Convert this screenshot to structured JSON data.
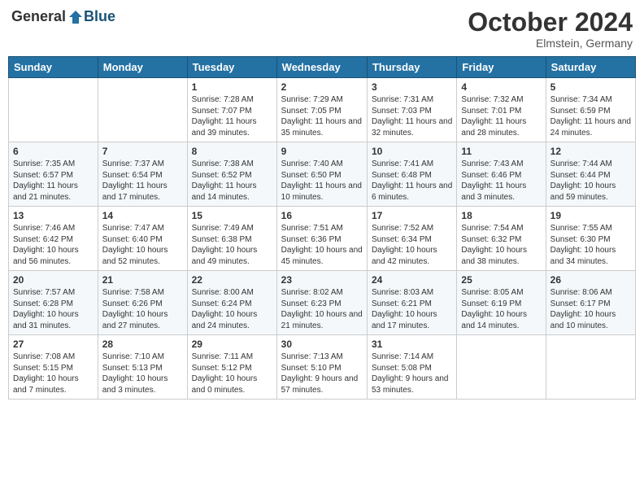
{
  "header": {
    "logo_general": "General",
    "logo_blue": "Blue",
    "month_title": "October 2024",
    "location": "Elmstein, Germany"
  },
  "weekdays": [
    "Sunday",
    "Monday",
    "Tuesday",
    "Wednesday",
    "Thursday",
    "Friday",
    "Saturday"
  ],
  "weeks": [
    [
      {
        "day": "",
        "content": ""
      },
      {
        "day": "",
        "content": ""
      },
      {
        "day": "1",
        "content": "Sunrise: 7:28 AM\nSunset: 7:07 PM\nDaylight: 11 hours\nand 39 minutes."
      },
      {
        "day": "2",
        "content": "Sunrise: 7:29 AM\nSunset: 7:05 PM\nDaylight: 11 hours\nand 35 minutes."
      },
      {
        "day": "3",
        "content": "Sunrise: 7:31 AM\nSunset: 7:03 PM\nDaylight: 11 hours\nand 32 minutes."
      },
      {
        "day": "4",
        "content": "Sunrise: 7:32 AM\nSunset: 7:01 PM\nDaylight: 11 hours\nand 28 minutes."
      },
      {
        "day": "5",
        "content": "Sunrise: 7:34 AM\nSunset: 6:59 PM\nDaylight: 11 hours\nand 24 minutes."
      }
    ],
    [
      {
        "day": "6",
        "content": "Sunrise: 7:35 AM\nSunset: 6:57 PM\nDaylight: 11 hours\nand 21 minutes."
      },
      {
        "day": "7",
        "content": "Sunrise: 7:37 AM\nSunset: 6:54 PM\nDaylight: 11 hours\nand 17 minutes."
      },
      {
        "day": "8",
        "content": "Sunrise: 7:38 AM\nSunset: 6:52 PM\nDaylight: 11 hours\nand 14 minutes."
      },
      {
        "day": "9",
        "content": "Sunrise: 7:40 AM\nSunset: 6:50 PM\nDaylight: 11 hours\nand 10 minutes."
      },
      {
        "day": "10",
        "content": "Sunrise: 7:41 AM\nSunset: 6:48 PM\nDaylight: 11 hours\nand 6 minutes."
      },
      {
        "day": "11",
        "content": "Sunrise: 7:43 AM\nSunset: 6:46 PM\nDaylight: 11 hours\nand 3 minutes."
      },
      {
        "day": "12",
        "content": "Sunrise: 7:44 AM\nSunset: 6:44 PM\nDaylight: 10 hours\nand 59 minutes."
      }
    ],
    [
      {
        "day": "13",
        "content": "Sunrise: 7:46 AM\nSunset: 6:42 PM\nDaylight: 10 hours\nand 56 minutes."
      },
      {
        "day": "14",
        "content": "Sunrise: 7:47 AM\nSunset: 6:40 PM\nDaylight: 10 hours\nand 52 minutes."
      },
      {
        "day": "15",
        "content": "Sunrise: 7:49 AM\nSunset: 6:38 PM\nDaylight: 10 hours\nand 49 minutes."
      },
      {
        "day": "16",
        "content": "Sunrise: 7:51 AM\nSunset: 6:36 PM\nDaylight: 10 hours\nand 45 minutes."
      },
      {
        "day": "17",
        "content": "Sunrise: 7:52 AM\nSunset: 6:34 PM\nDaylight: 10 hours\nand 42 minutes."
      },
      {
        "day": "18",
        "content": "Sunrise: 7:54 AM\nSunset: 6:32 PM\nDaylight: 10 hours\nand 38 minutes."
      },
      {
        "day": "19",
        "content": "Sunrise: 7:55 AM\nSunset: 6:30 PM\nDaylight: 10 hours\nand 34 minutes."
      }
    ],
    [
      {
        "day": "20",
        "content": "Sunrise: 7:57 AM\nSunset: 6:28 PM\nDaylight: 10 hours\nand 31 minutes."
      },
      {
        "day": "21",
        "content": "Sunrise: 7:58 AM\nSunset: 6:26 PM\nDaylight: 10 hours\nand 27 minutes."
      },
      {
        "day": "22",
        "content": "Sunrise: 8:00 AM\nSunset: 6:24 PM\nDaylight: 10 hours\nand 24 minutes."
      },
      {
        "day": "23",
        "content": "Sunrise: 8:02 AM\nSunset: 6:23 PM\nDaylight: 10 hours\nand 21 minutes."
      },
      {
        "day": "24",
        "content": "Sunrise: 8:03 AM\nSunset: 6:21 PM\nDaylight: 10 hours\nand 17 minutes."
      },
      {
        "day": "25",
        "content": "Sunrise: 8:05 AM\nSunset: 6:19 PM\nDaylight: 10 hours\nand 14 minutes."
      },
      {
        "day": "26",
        "content": "Sunrise: 8:06 AM\nSunset: 6:17 PM\nDaylight: 10 hours\nand 10 minutes."
      }
    ],
    [
      {
        "day": "27",
        "content": "Sunrise: 7:08 AM\nSunset: 5:15 PM\nDaylight: 10 hours\nand 7 minutes."
      },
      {
        "day": "28",
        "content": "Sunrise: 7:10 AM\nSunset: 5:13 PM\nDaylight: 10 hours\nand 3 minutes."
      },
      {
        "day": "29",
        "content": "Sunrise: 7:11 AM\nSunset: 5:12 PM\nDaylight: 10 hours\nand 0 minutes."
      },
      {
        "day": "30",
        "content": "Sunrise: 7:13 AM\nSunset: 5:10 PM\nDaylight: 9 hours\nand 57 minutes."
      },
      {
        "day": "31",
        "content": "Sunrise: 7:14 AM\nSunset: 5:08 PM\nDaylight: 9 hours\nand 53 minutes."
      },
      {
        "day": "",
        "content": ""
      },
      {
        "day": "",
        "content": ""
      }
    ]
  ]
}
